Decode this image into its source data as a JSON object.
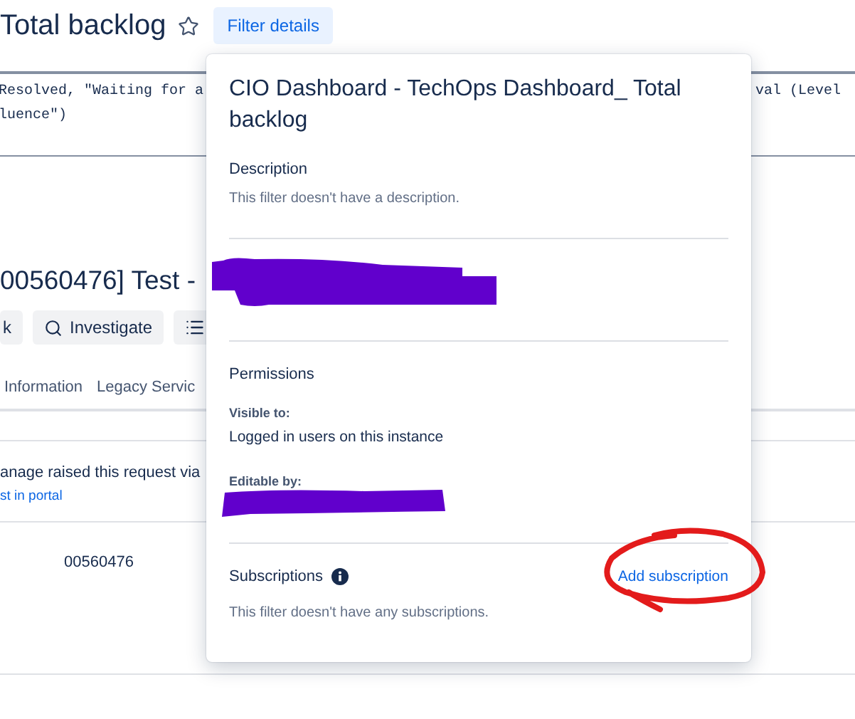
{
  "page": {
    "title": "Total backlog",
    "filter_button": "Filter details",
    "jql": {
      "lines": [
        "Resolved, \"Waiting for a",
        "luence\")"
      ],
      "right": "val (Level"
    },
    "issue_title": "00560476] Test -",
    "actions": [
      {
        "kind": "text",
        "label": "k"
      },
      {
        "kind": "icon-text",
        "label": "Investigate"
      },
      {
        "kind": "icon"
      }
    ],
    "tabs": [
      "Information",
      "Legacy Servic"
    ],
    "request_text": "anage raised this request via",
    "portal_link": "st in portal",
    "field_value": "00560476"
  },
  "popup": {
    "title": "CIO Dashboard - TechOps Dashboard_ Total backlog",
    "description": {
      "heading": "Description",
      "text": "This filter doesn't have a description."
    },
    "permissions": {
      "heading": "Permissions",
      "visible_label": "Visible to:",
      "visible_value": "Logged in users on this instance",
      "editable_label": "Editable by:"
    },
    "subscriptions": {
      "heading": "Subscriptions",
      "add_link": "Add subscription",
      "text": "This filter doesn't have any subscriptions."
    }
  }
}
